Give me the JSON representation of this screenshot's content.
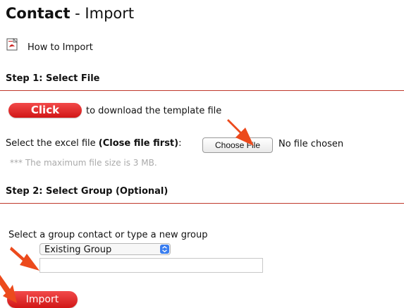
{
  "header": {
    "title_bold": "Contact",
    "title_rest": " - Import"
  },
  "help": {
    "link_label": "How to Import",
    "icon": "pdf-icon"
  },
  "step1": {
    "heading": "Step 1: Select File",
    "click_button_label": "Click",
    "download_text": "to download the template file",
    "excel_label_prefix": "Select the excel file ",
    "excel_label_bold": "(Close file first)",
    "excel_label_suffix": ":",
    "choose_file_label": "Choose File",
    "no_file_text": "No file chosen",
    "max_size_note": "*** The maximum file size is 3 MB."
  },
  "step2": {
    "heading": "Step 2: Select Group (Optional)",
    "group_label": "Select a group contact or type a new group",
    "group_select_value": "Existing Group",
    "group_input_value": ""
  },
  "footer": {
    "import_button_label": "Import"
  },
  "colors": {
    "accent_red": "#d11717",
    "rule_red": "#c0392b",
    "arrow": "#ec4a1c",
    "select_arrow": "#3a7ef0"
  }
}
